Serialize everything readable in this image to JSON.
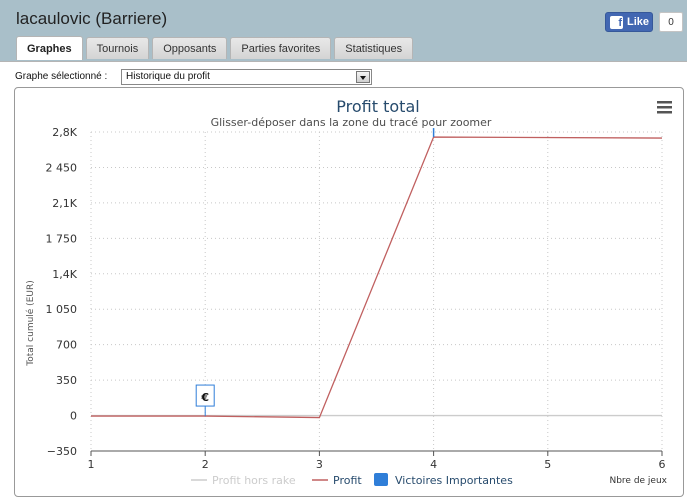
{
  "header": {
    "title": "lacaulovic (Barriere)",
    "like_label": "Like",
    "like_count": "0"
  },
  "tabs": [
    {
      "label": "Graphes",
      "active": true
    },
    {
      "label": "Tournois",
      "active": false
    },
    {
      "label": "Opposants",
      "active": false
    },
    {
      "label": "Parties favorites",
      "active": false
    },
    {
      "label": "Statistiques",
      "active": false
    }
  ],
  "graph_select": {
    "label": "Graphe sélectionné :",
    "value": "Historique du profit"
  },
  "icons": {
    "menu": "hamburger-menu-icon",
    "facebook": "facebook-f-icon",
    "dropdown": "chevron-down-icon",
    "marker": "euro-icon"
  },
  "colors": {
    "profit_line": "#c06060",
    "rake_line": "#cccccc",
    "victories": "#2f7ed8",
    "title": "#274b6d"
  },
  "chart_data": {
    "type": "line",
    "title": "Profit total",
    "subtitle": "Glisser-déposer dans la zone du tracé pour zoomer",
    "ylabel": "Total cumulé (EUR)",
    "xlabel": "Nbre de jeux",
    "x_ticks": [
      "1",
      "2",
      "3",
      "4",
      "5",
      "6"
    ],
    "y_ticks": [
      {
        "value": -350,
        "label": "−350"
      },
      {
        "value": 0,
        "label": "0"
      },
      {
        "value": 350,
        "label": "350"
      },
      {
        "value": 700,
        "label": "700"
      },
      {
        "value": 1050,
        "label": "1 050"
      },
      {
        "value": 1400,
        "label": "1,4K"
      },
      {
        "value": 1750,
        "label": "1 750"
      },
      {
        "value": 2100,
        "label": "2,1K"
      },
      {
        "value": 2450,
        "label": "2 450"
      },
      {
        "value": 2800,
        "label": "2,8K"
      }
    ],
    "xlim": [
      1,
      6
    ],
    "ylim": [
      -350,
      2800
    ],
    "grid": true,
    "legend_position": "bottom",
    "series": [
      {
        "name": "Profit hors rake",
        "x": [
          1,
          2,
          3,
          4,
          6
        ],
        "y": [
          0,
          0,
          0,
          0,
          0
        ],
        "color": "#cccccc"
      },
      {
        "name": "Profit",
        "x": [
          1,
          2,
          3,
          4,
          6
        ],
        "y": [
          -5,
          -5,
          -20,
          2750,
          2740
        ],
        "color": "#c06060"
      },
      {
        "name": "Victoires Importantes",
        "type": "flags",
        "x": [
          2,
          4
        ],
        "y": [
          -5,
          2750
        ],
        "labels": [
          "€",
          ""
        ],
        "color": "#2f7ed8"
      }
    ]
  }
}
